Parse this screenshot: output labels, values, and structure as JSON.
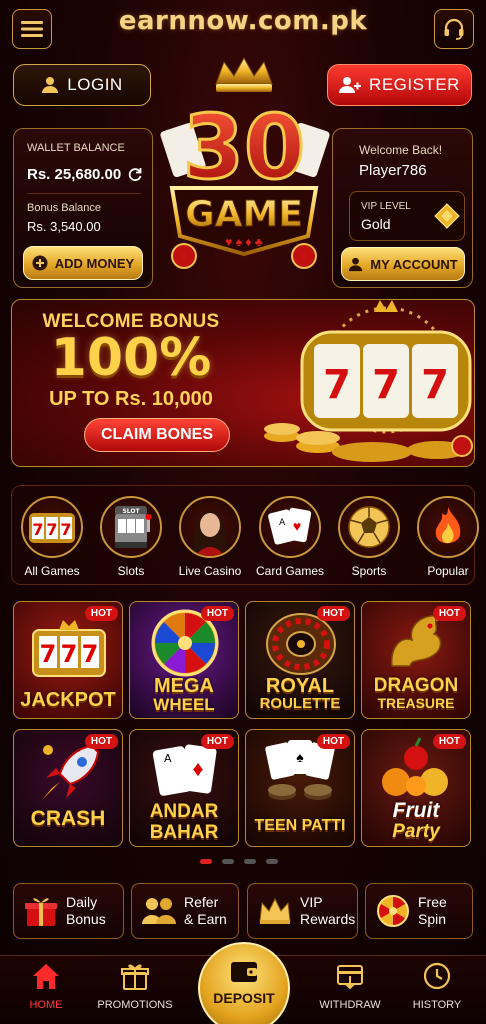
{
  "header": {
    "site_title": "earnnow.com.pk"
  },
  "auth": {
    "login_label": "LOGIN",
    "register_label": "REGISTER"
  },
  "logo": {
    "number": "30",
    "word": "GAME"
  },
  "wallet": {
    "balance_label": "WALLET BALANCE",
    "balance_value": "Rs. 25,680.00",
    "bonus_label": "Bonus Balance",
    "bonus_value": "Rs. 3,540.00",
    "add_money_label": "ADD MONEY"
  },
  "account": {
    "welcome": "Welcome Back!",
    "username": "Player786",
    "vip_label": "VIP LEVEL",
    "vip_value": "Gold",
    "my_account_label": "MY ACCOUNT"
  },
  "banner": {
    "line1": "WELCOME BONUS",
    "line2": "100%",
    "line3": "UP TO  Rs. 10,000",
    "claim_label": "CLAIM BONES"
  },
  "categories": [
    {
      "label": "All Games",
      "icon": "slot-777-icon"
    },
    {
      "label": "Slots",
      "icon": "slot-machine-icon"
    },
    {
      "label": "Live Casino",
      "icon": "dealer-avatar-icon"
    },
    {
      "label": "Card Games",
      "icon": "playing-cards-icon"
    },
    {
      "label": "Sports",
      "icon": "soccer-ball-icon"
    },
    {
      "label": "Popular",
      "icon": "flame-icon"
    }
  ],
  "games": [
    {
      "name1": "JACKPOT",
      "name2": "",
      "badge": "HOT"
    },
    {
      "name1": "MEGA",
      "name2": "WHEEL",
      "badge": "HOT"
    },
    {
      "name1": "ROYAL",
      "name2": "ROULETTE",
      "badge": "HOT"
    },
    {
      "name1": "DRAGON",
      "name2": "TREASURE",
      "badge": "HOT"
    },
    {
      "name1": "CRASH",
      "name2": "",
      "badge": "HOT"
    },
    {
      "name1": "ANDAR",
      "name2": "BAHAR",
      "badge": "HOT"
    },
    {
      "name1": "TEEN PATTI",
      "name2": "",
      "badge": "HOT"
    },
    {
      "name1": "Fruit",
      "name2": "Party",
      "badge": "HOT"
    }
  ],
  "carousel": {
    "pages": 4,
    "active": 1
  },
  "quick_actions": [
    {
      "line1": "Daily",
      "line2": "Bonus",
      "icon": "gift-icon"
    },
    {
      "line1": "Refer",
      "line2": "& Earn",
      "icon": "users-icon"
    },
    {
      "line1": "VIP",
      "line2": "Rewards",
      "icon": "crown-icon"
    },
    {
      "line1": "Free",
      "line2": "Spin",
      "icon": "spin-wheel-icon"
    }
  ],
  "nav": {
    "home": "HOME",
    "promotions": "PROMOTIONS",
    "deposit": "DEPOSIT",
    "withdraw": "WITHDRAW",
    "history": "HISTORY"
  },
  "colors": {
    "accent_gold": "#f5c542",
    "accent_red": "#e02020",
    "bg": "#1a0303"
  }
}
